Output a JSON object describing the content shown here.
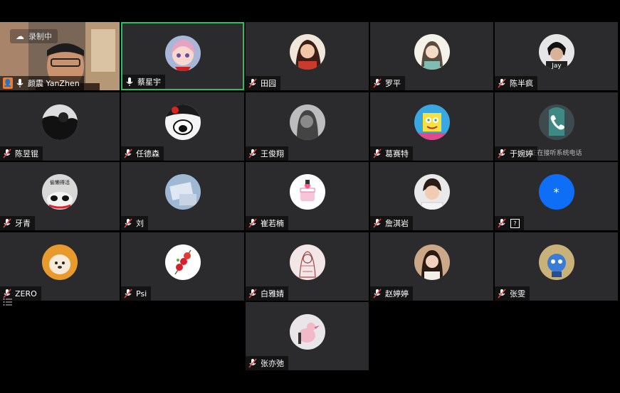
{
  "recording_label": "录制中",
  "phone_status": "正在接听系统电话",
  "colors": {
    "speaking_border": "#27c25f",
    "tile_bg": "#2b2b2d",
    "muted_mic": "#e04848"
  },
  "participants": [
    {
      "name": "颜震 YanZhen",
      "mic": "on",
      "video": true,
      "host_icon": "person-icon"
    },
    {
      "name": "蔡星宇",
      "mic": "on",
      "speaking": true,
      "avatar": "anime-girl-avatar"
    },
    {
      "name": "田园",
      "mic": "muted",
      "avatar": "illustration-girl-avatar"
    },
    {
      "name": "罗平",
      "mic": "muted",
      "avatar": "sketch-girl-avatar"
    },
    {
      "name": "陈半疯",
      "mic": "muted",
      "avatar": "jay-photo-avatar",
      "avatar_text": "Jay"
    },
    {
      "name": "陈昱锟",
      "mic": "muted",
      "avatar": "bw-silhouette-avatar"
    },
    {
      "name": "任德森",
      "mic": "muted",
      "avatar": "manga-avatar"
    },
    {
      "name": "王俊翔",
      "mic": "muted",
      "avatar": "grey-portrait-avatar"
    },
    {
      "name": "葛赛特",
      "mic": "muted",
      "avatar": "spongebob-avatar"
    },
    {
      "name": "于婉婷",
      "mic": "muted",
      "avatar": "phone-call-avatar"
    },
    {
      "name": "牙青",
      "mic": "muted",
      "avatar": "panda-avatar",
      "avatar_text": "偷懒得活"
    },
    {
      "name": "刘",
      "mic": "muted",
      "avatar": "blue-photo-avatar"
    },
    {
      "name": "崔若楠",
      "mic": "muted",
      "avatar": "cake-avatar"
    },
    {
      "name": "詹淇岩",
      "mic": "muted",
      "avatar": "boy-photo-avatar"
    },
    {
      "name": "?",
      "mic": "muted",
      "avatar": "blue-star-avatar",
      "avatar_text": "*"
    },
    {
      "name": "ZERO",
      "mic": "muted",
      "avatar": "dog-avatar"
    },
    {
      "name": "Psi",
      "mic": "muted",
      "avatar": "candied-fruit-avatar"
    },
    {
      "name": "白雅婧",
      "mic": "muted",
      "avatar": "sketch-figure-avatar"
    },
    {
      "name": "赵婷婷",
      "mic": "muted",
      "avatar": "girl-photo-avatar"
    },
    {
      "name": "张雯",
      "mic": "muted",
      "avatar": "blue-robot-avatar"
    },
    {
      "name": "张亦弛",
      "mic": "muted",
      "avatar": "pink-bird-avatar"
    }
  ]
}
